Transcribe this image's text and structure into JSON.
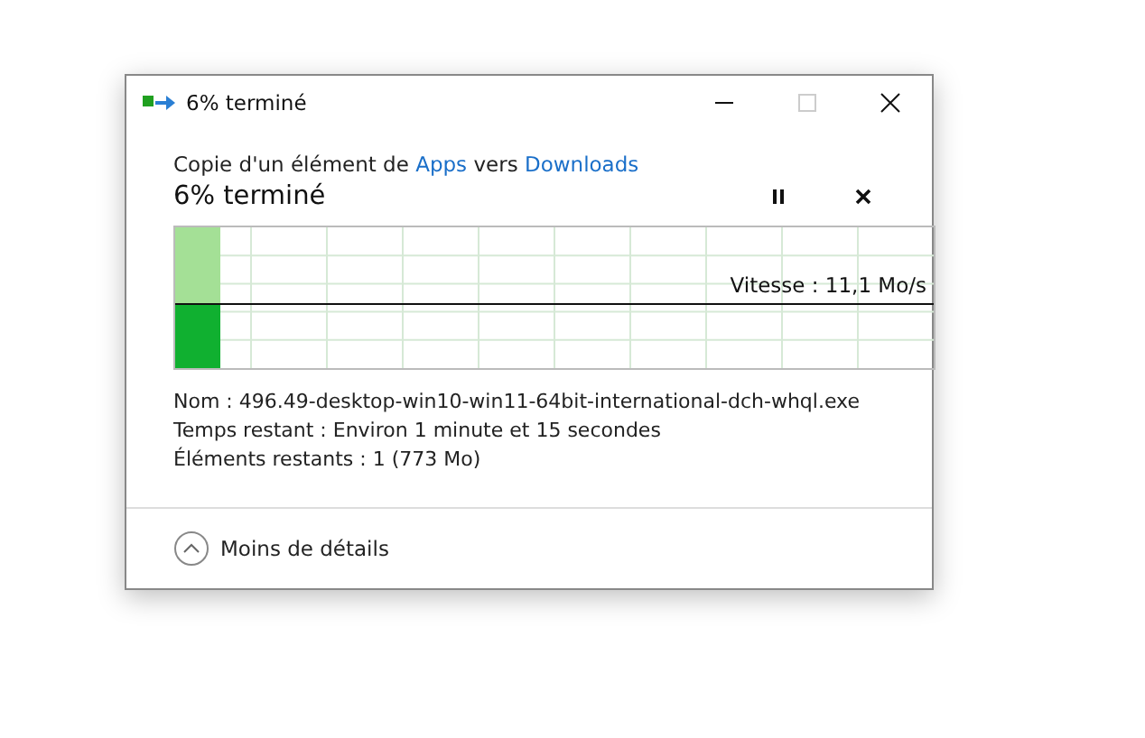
{
  "window": {
    "title": "6% terminé",
    "maximize_disabled": true
  },
  "description": {
    "prefix": "Copie d'un élément de ",
    "source": "Apps",
    "middle": " vers ",
    "destination": "Downloads"
  },
  "progress": {
    "heading": "6% terminé",
    "level": 0.06,
    "speed": "Vitesse : 11,1 Mo/s"
  },
  "details": [
    {
      "label": "Nom :",
      "value": "496.49-desktop-win10-win11-64bit-international-dch-whql.exe"
    },
    {
      "label": "Temps restant :",
      "value": "Environ 1 minute et 15 secondes"
    },
    {
      "label": "Éléments restants :",
      "value": "1 (773 Mo)"
    }
  ],
  "footer": {
    "toggle": "Moins de détails",
    "expanded": true
  }
}
